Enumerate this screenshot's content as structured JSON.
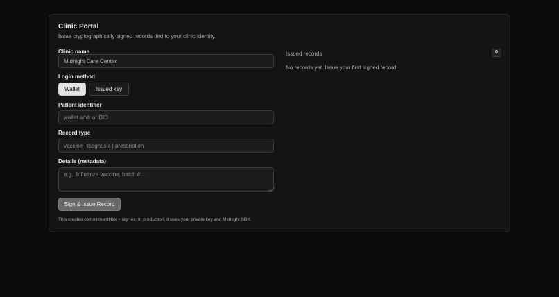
{
  "portal": {
    "title": "Clinic Portal",
    "subtitle": "Issue cryptographically signed records tied to your clinic identity."
  },
  "form": {
    "clinic_name_label": "Clinic name",
    "clinic_name_value": "Midnight Care Center",
    "login_method_label": "Login method",
    "login_options": [
      "Wallet",
      "Issued key"
    ],
    "login_selected": "Wallet",
    "patient_label": "Patient identifier",
    "patient_placeholder": "wallet addr or DID",
    "record_type_label": "Record type",
    "record_type_placeholder": "vaccine | diagnosis | prescription",
    "details_label": "Details (metadata)",
    "details_placeholder": "e.g., Influenza vaccine, batch #...",
    "submit_label": "Sign & Issue Record",
    "footnote": "This creates commitmentHex + sigHex. In production, it uses your private key and Midnight SDK."
  },
  "records": {
    "heading": "Issued records",
    "count": "0",
    "empty_message": "No records yet. Issue your first signed record."
  }
}
